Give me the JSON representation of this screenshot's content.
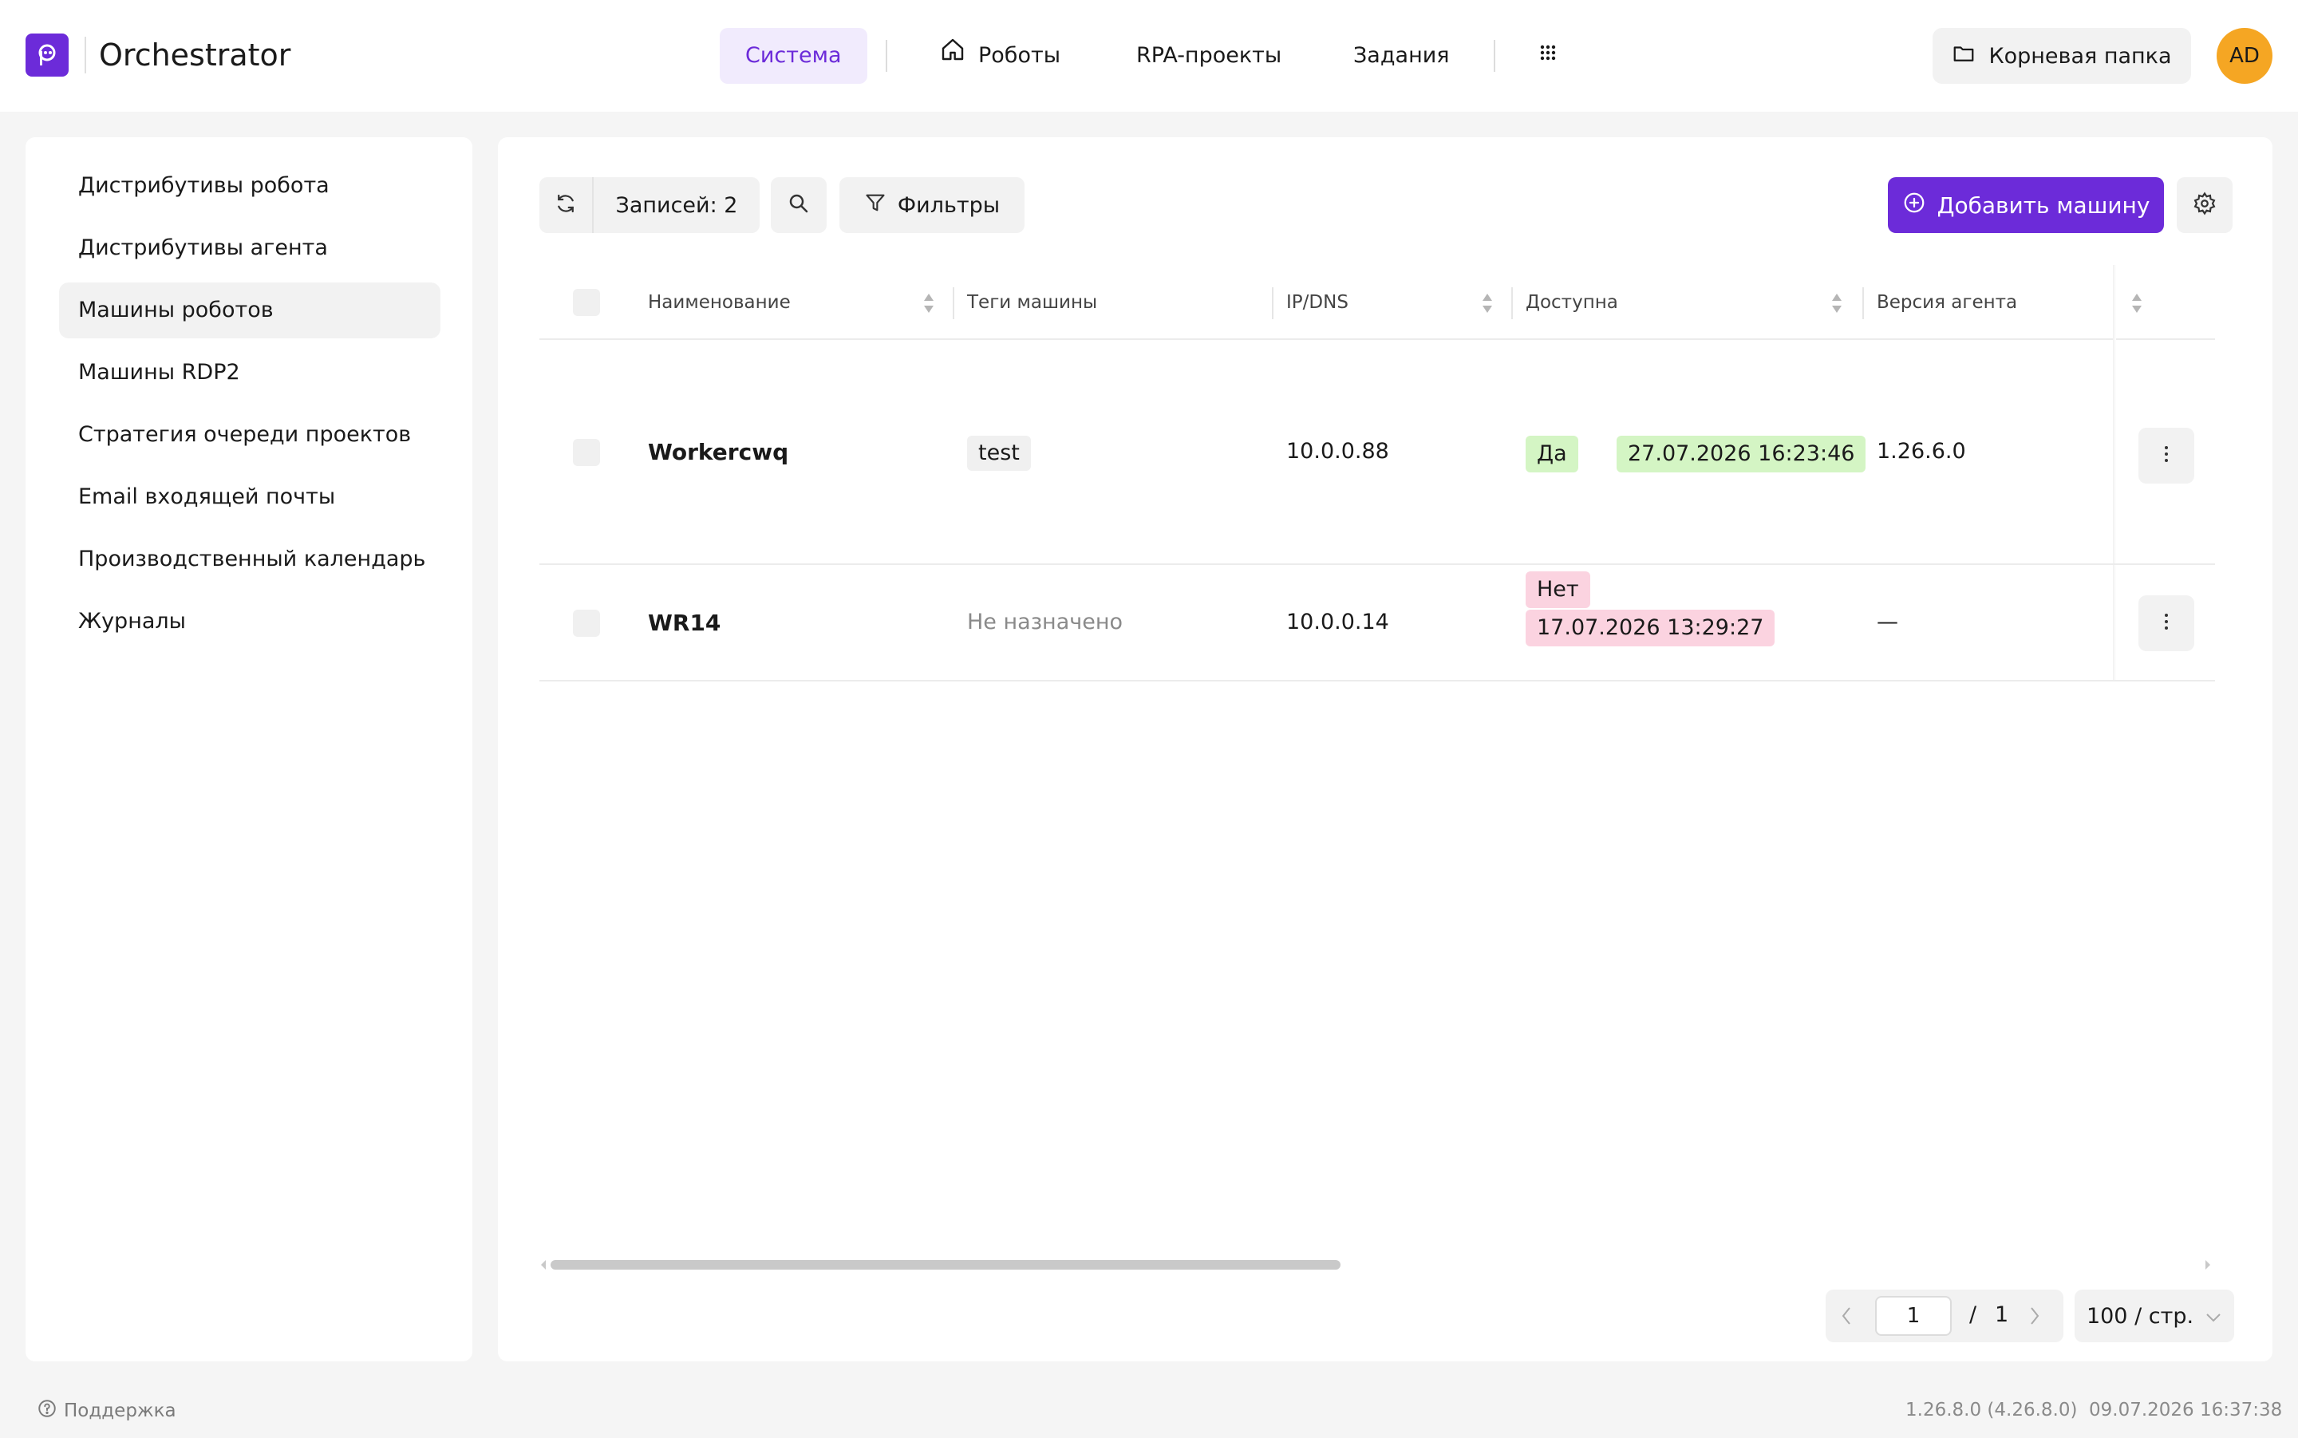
{
  "app": {
    "title": "Orchestrator",
    "accent_color": "#6c2bd9",
    "avatar_initials": "AD"
  },
  "nav": {
    "system": "Система",
    "robots": "Роботы",
    "rpa_projects": "RPA-проекты",
    "tasks": "Задания",
    "root_folder": "Корневая папка"
  },
  "sidebar": {
    "items": [
      {
        "label": "Дистрибутивы робота",
        "active": false
      },
      {
        "label": "Дистрибутивы агента",
        "active": false
      },
      {
        "label": "Машины роботов",
        "active": true
      },
      {
        "label": "Машины RDP2",
        "active": false
      },
      {
        "label": "Стратегия очереди проектов",
        "active": false
      },
      {
        "label": "Email входящей почты",
        "active": false
      },
      {
        "label": "Производственный календарь",
        "active": false
      },
      {
        "label": "Журналы",
        "active": false
      }
    ]
  },
  "toolbar": {
    "records_label": "Записей: 2",
    "filters_label": "Фильтры",
    "add_machine_label": "Добавить машину"
  },
  "table": {
    "columns": [
      "Наименование",
      "Теги машины",
      "IP/DNS",
      "Доступна",
      "Версия агента"
    ],
    "rows": [
      {
        "name": "Workercwq",
        "tag": "test",
        "ip": "10.0.0.88",
        "available": "Да",
        "available_time": "27.07.2026 16:23:46",
        "agent_version": "1.26.6.0"
      },
      {
        "name": "WR14",
        "tag": "Не назначено",
        "ip": "10.0.0.14",
        "available": "Нет",
        "available_time": "17.07.2026 13:29:27",
        "agent_version": "—"
      }
    ]
  },
  "pagination": {
    "current_page": "1",
    "separator": "/",
    "total_pages": "1",
    "page_size": "100 / стр."
  },
  "footer": {
    "support": "Поддержка",
    "version": "1.26.8.0 (4.26.8.0)",
    "datetime": "09.07.2026 16:37:38"
  },
  "icons": [
    "logo-icon",
    "home-icon",
    "apps-grid-icon",
    "folder-icon",
    "refresh-icon",
    "search-icon",
    "filter-icon",
    "plus-circle-icon",
    "gear-icon",
    "more-vertical-icon",
    "chevron-left-icon",
    "chevron-right-icon",
    "chevron-down-icon",
    "help-circle-icon"
  ]
}
